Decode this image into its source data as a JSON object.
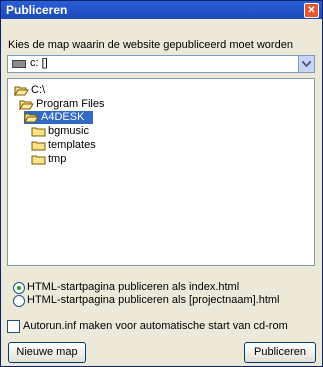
{
  "window": {
    "title": "Publiceren"
  },
  "prompt": "Kies de map waarin de website gepubliceerd moet worden",
  "drive": {
    "label": "c: []"
  },
  "tree": {
    "nodes": [
      {
        "label": "C:\\"
      },
      {
        "label": "Program Files"
      },
      {
        "label": "A4DESK"
      },
      {
        "label": "bgmusic"
      },
      {
        "label": "templates"
      },
      {
        "label": "tmp"
      }
    ]
  },
  "options": {
    "radio_index": "HTML-startpagina publiceren als index.html",
    "radio_project": "HTML-startpagina publiceren als [projectnaam].html",
    "autorun": "Autorun.inf maken voor automatische start van cd-rom"
  },
  "buttons": {
    "new_folder": "Nieuwe map",
    "publish": "Publiceren"
  },
  "colors": {
    "titlebar": "#2a5fd6",
    "selection": "#316ac5",
    "window_bg": "#ece9d8"
  }
}
